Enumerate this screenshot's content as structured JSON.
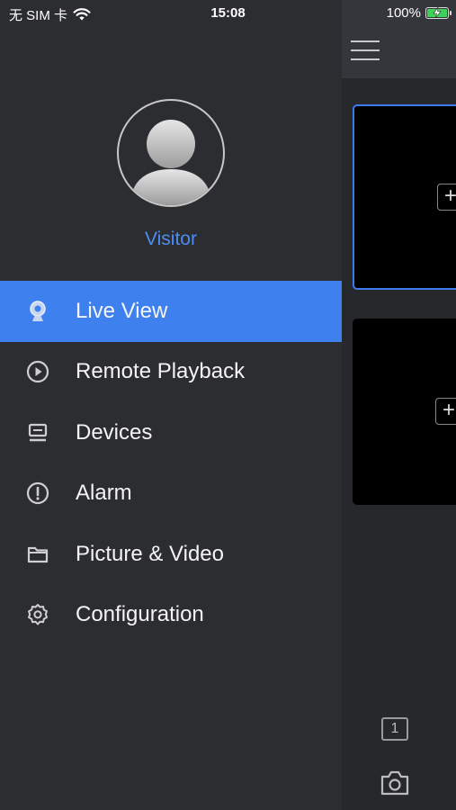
{
  "status_bar": {
    "carrier": "无 SIM 卡",
    "time": "15:08",
    "battery": "100%"
  },
  "profile": {
    "name": "Visitor"
  },
  "menu": {
    "items": [
      {
        "label": "Live View",
        "icon": "camera-icon",
        "active": true
      },
      {
        "label": "Remote Playback",
        "icon": "play-circle-icon",
        "active": false
      },
      {
        "label": "Devices",
        "icon": "device-icon",
        "active": false
      },
      {
        "label": "Alarm",
        "icon": "alarm-icon",
        "active": false
      },
      {
        "label": "Picture & Video",
        "icon": "folder-icon",
        "active": false
      },
      {
        "label": "Configuration",
        "icon": "gear-icon",
        "active": false
      }
    ]
  },
  "live_view": {
    "add_label": "+",
    "window_count": "1"
  },
  "colors": {
    "accent": "#3f80ef",
    "visitor_text": "#4c8cf5",
    "drawer_bg": "#2c2d31"
  }
}
